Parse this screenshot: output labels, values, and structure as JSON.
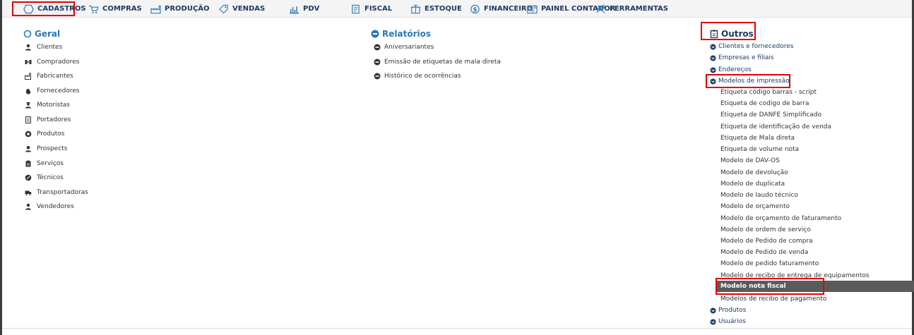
{
  "colors": {
    "accent": "#2d78b8",
    "highlight": "#e30000",
    "selected": "#5a5a5a",
    "menu_text": "#1d3a63"
  },
  "menu": [
    {
      "label": "CADASTROS",
      "icon": "hexagon-icon"
    },
    {
      "label": "COMPRAS",
      "icon": "cart-icon"
    },
    {
      "label": "PRODUÇÃO",
      "icon": "factory-icon"
    },
    {
      "label": "VENDAS",
      "icon": "tag-icon"
    },
    {
      "label": "PDV",
      "icon": "chart-icon"
    },
    {
      "label": "FISCAL",
      "icon": "document-icon"
    },
    {
      "label": "ESTOQUE",
      "icon": "box-icon"
    },
    {
      "label": "FINANCEIRO",
      "icon": "dollar-icon"
    },
    {
      "label": "PAINEL CONTADOR",
      "icon": "panel-icon"
    },
    {
      "label": "FERRAMENTAS",
      "icon": "tools-icon"
    }
  ],
  "geral": {
    "title": "Geral",
    "items": [
      {
        "label": "Clientes",
        "icon": "user-icon"
      },
      {
        "label": "Compradores",
        "icon": "handshake-icon"
      },
      {
        "label": "Fabricantes",
        "icon": "factory-icon"
      },
      {
        "label": "Fornecedores",
        "icon": "hand-icon"
      },
      {
        "label": "Motoristas",
        "icon": "driver-icon"
      },
      {
        "label": "Portadores",
        "icon": "card-icon"
      },
      {
        "label": "Produtos",
        "icon": "product-icon"
      },
      {
        "label": "Prospects",
        "icon": "prospect-icon"
      },
      {
        "label": "Serviços",
        "icon": "clipboard-icon"
      },
      {
        "label": "Técnicos",
        "icon": "wrench-icon"
      },
      {
        "label": "Transportadoras",
        "icon": "truck-icon"
      },
      {
        "label": "Vendedores",
        "icon": "seller-icon"
      }
    ]
  },
  "relatorios": {
    "title": "Relatórios",
    "items": [
      {
        "label": "Aniversariantes"
      },
      {
        "label": "Emissão de etiquetas de mala direta"
      },
      {
        "label": "Histórico de ocorrências"
      }
    ]
  },
  "outros": {
    "title": "Outros",
    "groups_top": [
      {
        "label": "Clientes e fornecedores"
      },
      {
        "label": "Empresas e filiais"
      },
      {
        "label": "Endereços"
      },
      {
        "label": "Modelos de impressão"
      }
    ],
    "subitems": [
      "Etiqueta código barras - script",
      "Etiqueta de codigo de barra",
      "Etiqueta de DANFE Simplificado",
      "Etiqueta de identificação de venda",
      "Etiqueta de Mala direta",
      "Etiqueta de volume nota",
      "Modelo de DAV-OS",
      "Modelo de devolução",
      "Modelo de duplicata",
      "Modelo de laudo técnico",
      "Modelo de orçamento",
      "Modelo de orçamento de faturamento",
      "Modelo de ordem de serviço",
      "Modelo de Pedido de compra",
      "Modelo de Pedido de venda",
      "Modelo de pedido faturamento",
      "Modelo de recibo de entrega de equipamentos"
    ],
    "selected": "Modelo nota fiscal",
    "after_selected": "Modelos de recibo de pagamento",
    "groups_bottom": [
      {
        "label": "Produtos"
      },
      {
        "label": "Usuários"
      }
    ]
  }
}
